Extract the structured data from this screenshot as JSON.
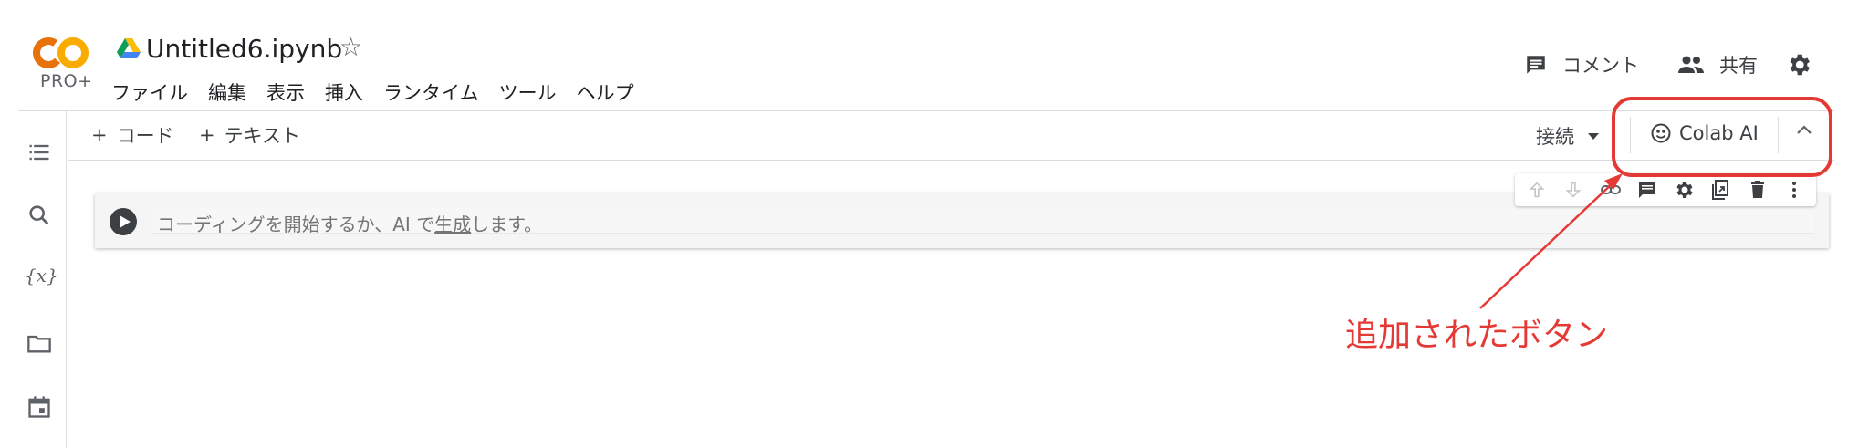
{
  "header": {
    "logo_text": "CO",
    "logo_plus": "PRO+",
    "doc_title": "Untitled6.ipynb",
    "menu": [
      "ファイル",
      "編集",
      "表示",
      "挿入",
      "ランタイム",
      "ツール",
      "ヘルプ"
    ],
    "comment_label": "コメント",
    "share_label": "共有"
  },
  "toolbar": {
    "add_code": "コード",
    "add_text": "テキスト",
    "connect_label": "接続",
    "colab_ai_label": "Colab AI"
  },
  "cell": {
    "placeholder_before": "コーディングを開始するか、AI で",
    "placeholder_link": "生成",
    "placeholder_after": "します。"
  },
  "annotation": {
    "text": "追加されたボタン",
    "color": "#e53935"
  },
  "colors": {
    "logo_orange": "#f9ab00",
    "logo_dark_orange": "#e8710a",
    "icon_gray": "#5f6368",
    "divider": "#dadce0"
  }
}
